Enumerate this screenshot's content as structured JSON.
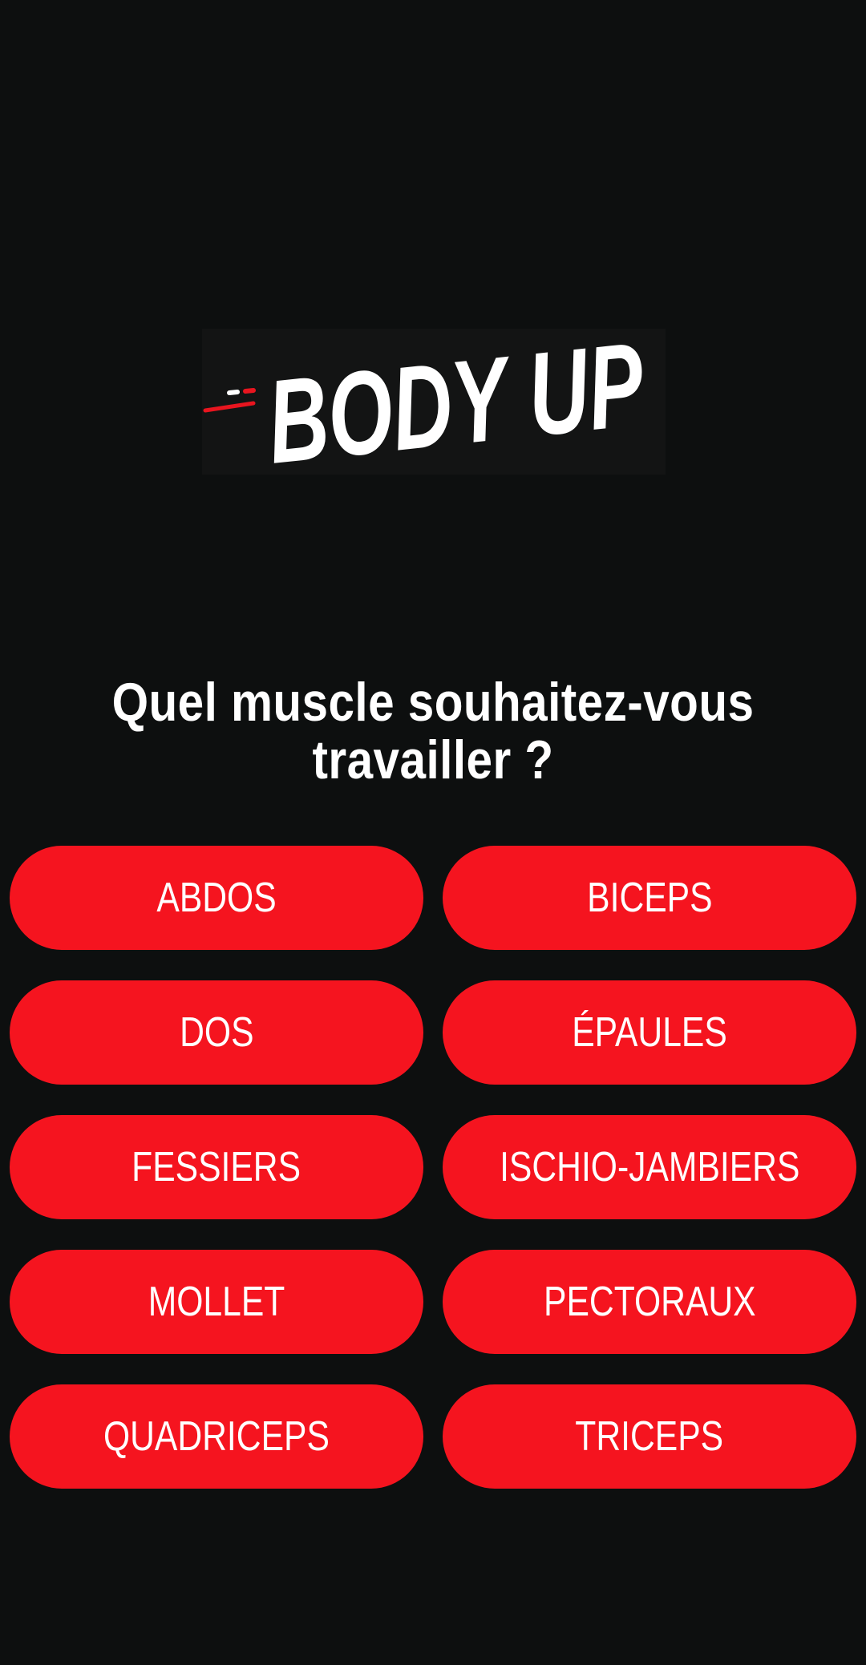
{
  "logo": {
    "text": "BODY UP",
    "accent_color": "#e8151f",
    "text_color": "#ffffff"
  },
  "prompt": {
    "line1": "Quel muscle souhaitez-vous",
    "line2": "travailler ?"
  },
  "colors": {
    "background": "#0d0f0f",
    "button": "#f5141f",
    "button_text": "#ffffff"
  },
  "muscles": [
    {
      "label": "ABDOS"
    },
    {
      "label": "BICEPS"
    },
    {
      "label": "DOS"
    },
    {
      "label": "ÉPAULES"
    },
    {
      "label": "FESSIERS"
    },
    {
      "label": "ISCHIO-JAMBIERS"
    },
    {
      "label": "MOLLET"
    },
    {
      "label": "PECTORAUX"
    },
    {
      "label": "QUADRICEPS"
    },
    {
      "label": "TRICEPS"
    }
  ]
}
